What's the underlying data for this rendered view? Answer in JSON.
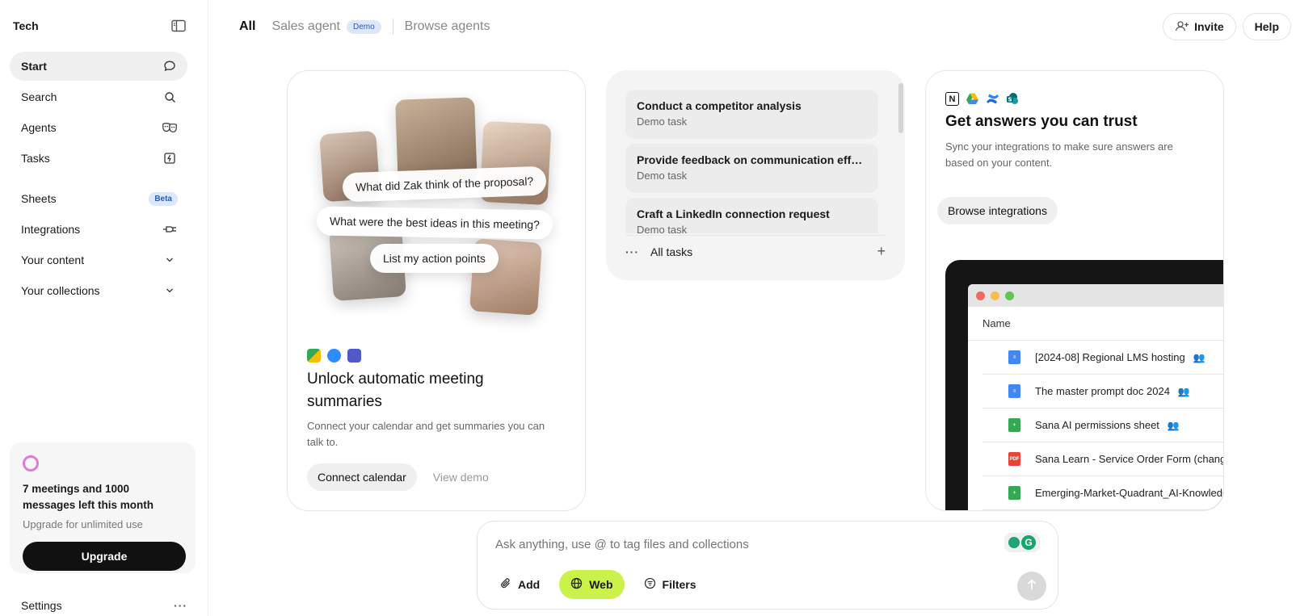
{
  "sidebar": {
    "workspace_name": "Tech",
    "items": [
      {
        "label": "Start",
        "icon": "chat-icon"
      },
      {
        "label": "Search",
        "icon": "search-icon"
      },
      {
        "label": "Agents",
        "icon": "masks-icon"
      },
      {
        "label": "Tasks",
        "icon": "task-icon"
      },
      {
        "label": "Sheets",
        "badge": "Beta"
      },
      {
        "label": "Integrations",
        "icon": "plug-icon"
      },
      {
        "label": "Your content",
        "icon": "chevron-down-icon"
      },
      {
        "label": "Your collections",
        "icon": "chevron-down-icon"
      }
    ],
    "quota": {
      "title": "7 meetings and 1000 messages left this month",
      "subtitle": "Upgrade for unlimited use",
      "button": "Upgrade"
    },
    "settings_label": "Settings"
  },
  "tabs": {
    "all": "All",
    "sales_agent": "Sales agent",
    "demo_badge": "Demo",
    "browse_agents": "Browse agents"
  },
  "top_right": {
    "invite": "Invite",
    "help": "Help"
  },
  "meeting_card": {
    "bubbles": [
      "What did Zak think of the proposal?",
      "What were the best ideas in this meeting?",
      "List my action points"
    ],
    "title": "Unlock automatic meeting summaries",
    "subtitle": "Connect your calendar and get summaries you can talk to.",
    "primary_button": "Connect calendar",
    "secondary_button": "View demo"
  },
  "tasks_card": {
    "tasks": [
      {
        "title": "Conduct a competitor analysis",
        "subtitle": "Demo task"
      },
      {
        "title": "Provide feedback on communication effectiv...",
        "subtitle": "Demo task"
      },
      {
        "title": "Craft a LinkedIn connection request",
        "subtitle": "Demo task"
      }
    ],
    "all_tasks": "All tasks"
  },
  "integrations_card": {
    "title": "Get answers you can trust",
    "subtitle": "Sync your integrations to make sure answers are based on your content.",
    "button": "Browse integrations",
    "mock": {
      "column_header": "Name",
      "files": [
        {
          "name": "[2024-08] Regional LMS hosting",
          "type": "doc",
          "shared": true
        },
        {
          "name": "The master prompt doc 2024",
          "type": "doc",
          "shared": true
        },
        {
          "name": "Sana AI permissions sheet",
          "type": "sheet",
          "shared": true
        },
        {
          "name": "Sana Learn - Service Order Form (change o",
          "type": "pdf",
          "shared": false
        },
        {
          "name": "Emerging-Market-Quadrant_AI-Knowledge",
          "type": "sheet",
          "shared": false
        }
      ],
      "pdf_label": "PDF"
    }
  },
  "composer": {
    "placeholder": "Ask anything, use @ to tag files and collections",
    "add": "Add",
    "web": "Web",
    "filters": "Filters"
  },
  "colors": {
    "accent_web": "#cbf24a",
    "badge_bg": "#dbe8fb",
    "badge_text": "#2a5bb8",
    "upgrade_bg": "#111111"
  }
}
